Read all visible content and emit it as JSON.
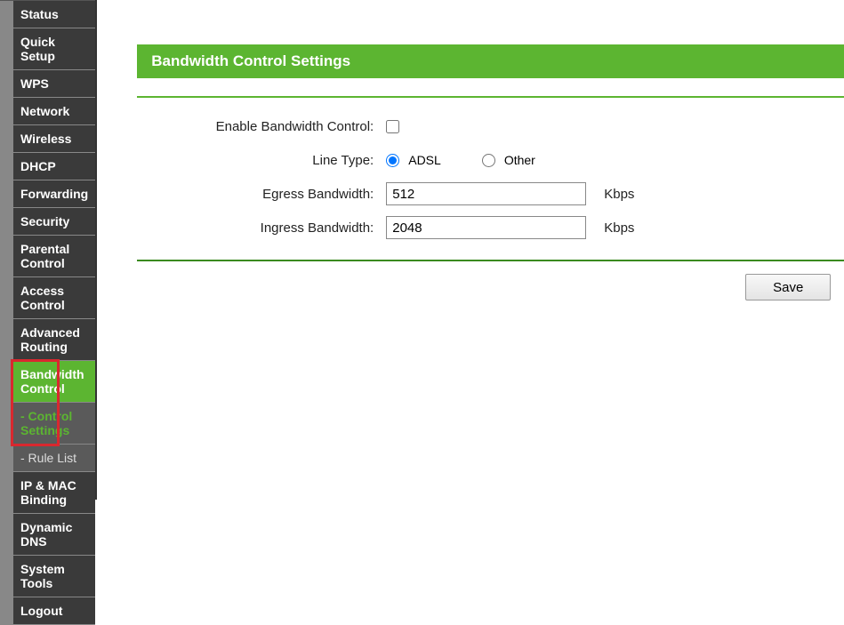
{
  "sidebar": {
    "items": [
      {
        "label": "Status"
      },
      {
        "label": "Quick Setup"
      },
      {
        "label": "WPS"
      },
      {
        "label": "Network"
      },
      {
        "label": "Wireless"
      },
      {
        "label": "DHCP"
      },
      {
        "label": "Forwarding"
      },
      {
        "label": "Security"
      },
      {
        "label": "Parental Control"
      },
      {
        "label": "Access Control"
      },
      {
        "label": "Advanced Routing"
      },
      {
        "label": "Bandwidth Control"
      },
      {
        "label": "- Control Settings"
      },
      {
        "label": "- Rule List"
      },
      {
        "label": "IP & MAC Binding"
      },
      {
        "label": "Dynamic DNS"
      },
      {
        "label": "System Tools"
      },
      {
        "label": "Logout"
      }
    ]
  },
  "page": {
    "title": "Bandwidth Control Settings",
    "labels": {
      "enable": "Enable Bandwidth Control:",
      "line_type": "Line Type:",
      "egress": "Egress Bandwidth:",
      "ingress": "Ingress Bandwidth:"
    },
    "line_type": {
      "opt1": "ADSL",
      "opt2": "Other",
      "selected": "ADSL"
    },
    "values": {
      "egress": "512",
      "ingress": "2048"
    },
    "unit": "Kbps",
    "save_label": "Save"
  }
}
